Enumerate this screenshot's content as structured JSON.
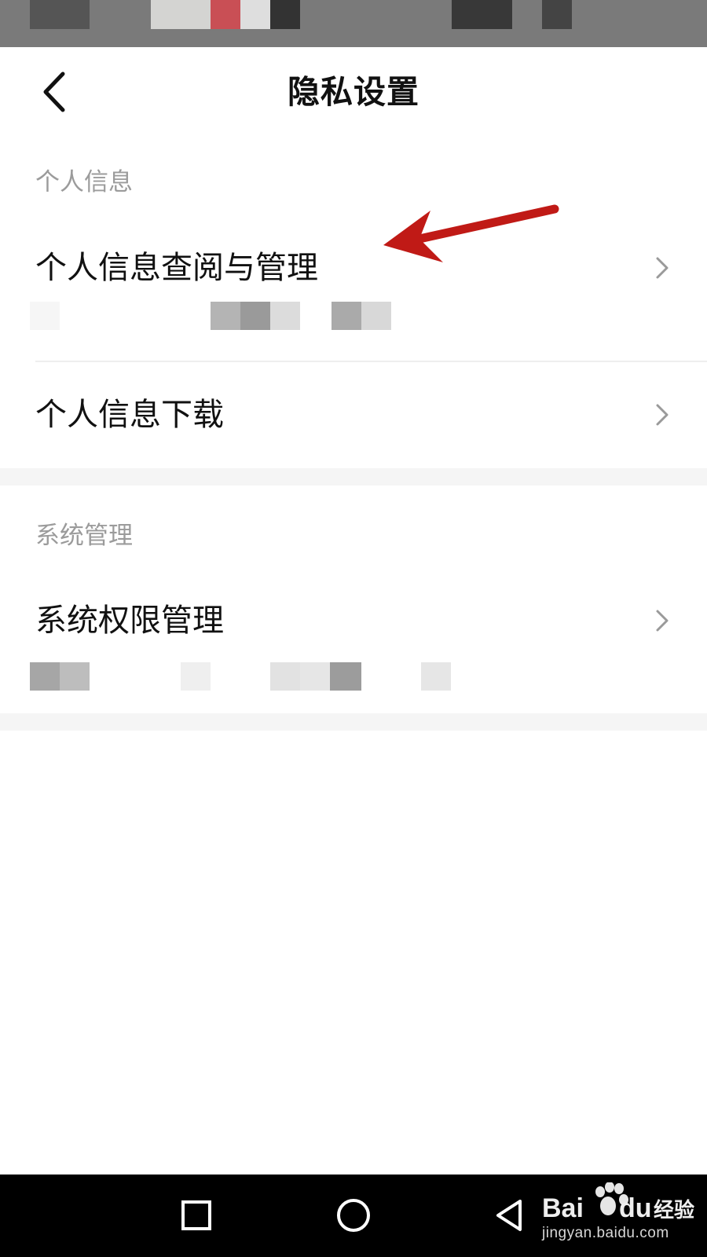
{
  "header": {
    "title": "隐私设置",
    "back_icon": "chevron-left-icon"
  },
  "sections": [
    {
      "label": "个人信息",
      "items": [
        {
          "label": "个人信息查阅与管理",
          "icon": "chevron-right-icon"
        },
        {
          "label": "个人信息下载",
          "icon": "chevron-right-icon"
        }
      ]
    },
    {
      "label": "系统管理",
      "items": [
        {
          "label": "系统权限管理",
          "icon": "chevron-right-icon"
        }
      ]
    }
  ],
  "annotation": {
    "icon": "red-arrow-icon",
    "color": "#c01a16"
  },
  "nav_bar": {
    "buttons": [
      "recents-square-icon",
      "home-circle-icon",
      "back-triangle-icon"
    ]
  },
  "watermark": {
    "logo": "Baidu经验",
    "url": "jingyan.baidu.com"
  }
}
